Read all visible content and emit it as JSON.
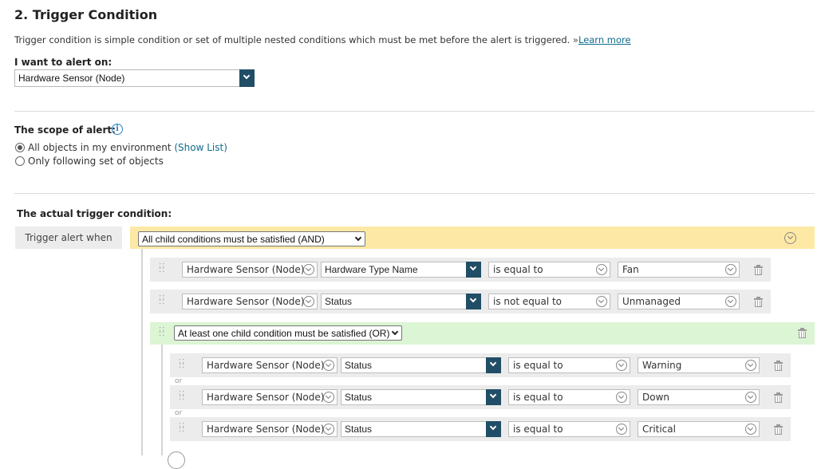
{
  "header": {
    "title": "2. Trigger Condition",
    "description": "Trigger condition is simple condition or set of multiple nested conditions which must be met before the alert is triggered.",
    "learn_prefix": " »",
    "learn_more": "Learn more"
  },
  "alert_on": {
    "label": "I want to alert on:",
    "value": "Hardware Sensor (Node)"
  },
  "scope": {
    "label": "The scope of alert:",
    "option_all": "All objects in my environment",
    "show_list": "(Show List)",
    "option_following": "Only following set of objects",
    "selected": "all"
  },
  "trigger": {
    "section_label": "The actual trigger condition:",
    "when_label": "Trigger alert when",
    "and_select": "All child conditions must be satisfied (AND)",
    "or_select": "At least one child condition must be satisfied (OR)",
    "or_separator": "or",
    "conditions": [
      {
        "object": "Hardware Sensor (Node)",
        "field": "Hardware Type Name",
        "operator": "is equal to",
        "value": "Fan"
      },
      {
        "object": "Hardware Sensor (Node)",
        "field": "Status",
        "operator": "is not equal to",
        "value": "Unmanaged"
      }
    ],
    "or_conditions": [
      {
        "object": "Hardware Sensor (Node)",
        "field": "Status",
        "operator": "is equal to",
        "value": "Warning"
      },
      {
        "object": "Hardware Sensor (Node)",
        "field": "Status",
        "operator": "is equal to",
        "value": "Down"
      },
      {
        "object": "Hardware Sensor (Node)",
        "field": "Status",
        "operator": "is equal to",
        "value": "Critical"
      }
    ]
  },
  "colors": {
    "accent_dark": "#204e66",
    "link": "#0f6c8e",
    "and_bar": "#fde9a5",
    "or_bar": "#dcf5d4",
    "info": "#2b84c5"
  },
  "icons": [
    "chevron-down-icon",
    "info-icon",
    "drag-handle-icon",
    "delete-icon",
    "collapse-icon"
  ]
}
